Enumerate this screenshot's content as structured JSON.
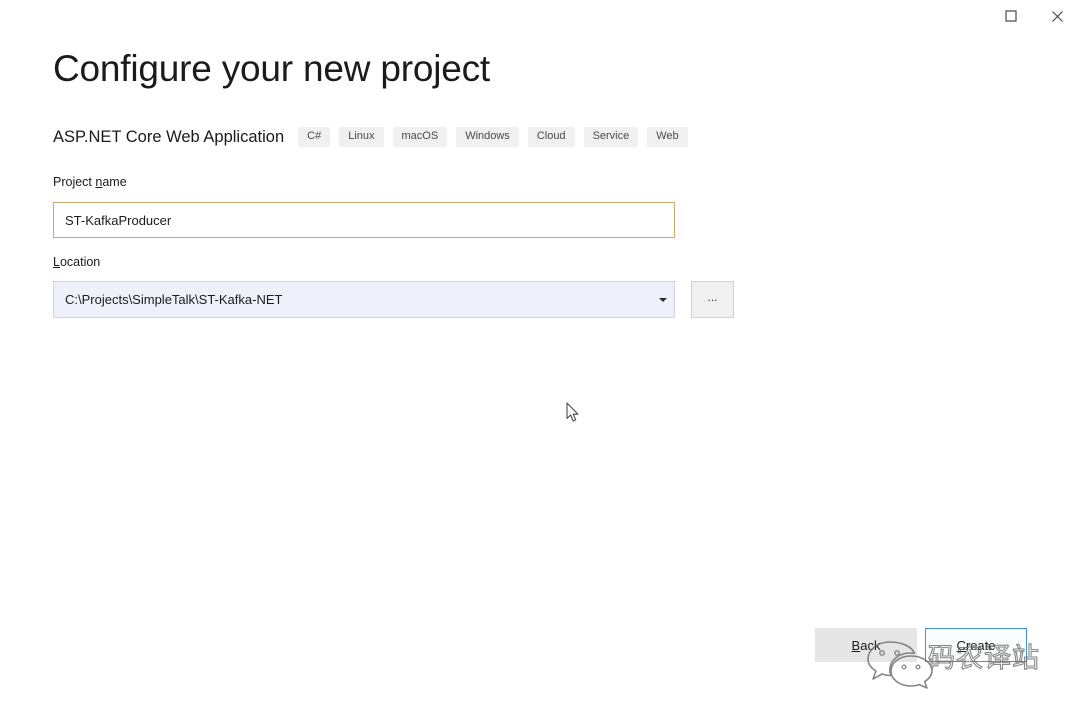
{
  "window": {
    "buttons": [
      {
        "name": "maximize",
        "icon": "maximize-icon",
        "tooltip": "Maximize"
      },
      {
        "name": "close",
        "icon": "close-icon",
        "tooltip": "Close"
      }
    ]
  },
  "page": {
    "title": "Configure your new project",
    "template_name": "ASP.NET Core Web Application",
    "tags": [
      "C#",
      "Linux",
      "macOS",
      "Windows",
      "Cloud",
      "Service",
      "Web"
    ]
  },
  "form": {
    "project_name": {
      "label_before": "Project ",
      "label_accelerator": "n",
      "label_after": "ame",
      "value": "ST-KafkaProducer",
      "placeholder": "",
      "border_color": "#c8a96c"
    },
    "location": {
      "label_before": "",
      "label_accelerator": "L",
      "label_after": "ocation",
      "value": "C:\\Projects\\SimpleTalk\\ST-Kafka-NET",
      "dropdown_icon": "chevron-down-icon",
      "browse_label": "...",
      "fill_color": "#eef1f9"
    }
  },
  "footer": {
    "back": {
      "label_before": "",
      "label_accelerator": "B",
      "label_after": "ack",
      "fill_color": "#e6e6e6"
    },
    "create": {
      "label_before": "",
      "label_accelerator": "C",
      "label_after": "reate",
      "border_color": "#3f93d8"
    }
  },
  "overlay": {
    "watermark_text": "码农译站",
    "watermark_icon": "wechat-icon",
    "cursor_icon": "arrow-cursor-icon"
  }
}
